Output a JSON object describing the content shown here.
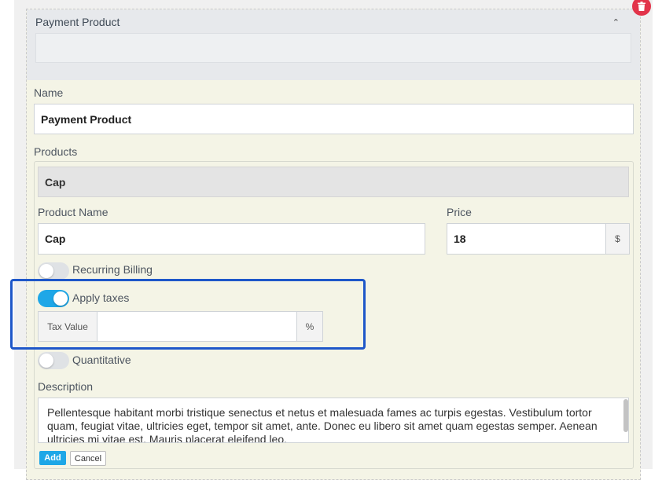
{
  "panel": {
    "title": "Payment Product",
    "collapse_icon": "chevron-up-icon",
    "delete_icon": "trash-icon"
  },
  "form": {
    "name_label": "Name",
    "name_value": "Payment Product",
    "products_label": "Products"
  },
  "product": {
    "header": "Cap",
    "name_label": "Product Name",
    "name_value": "Cap",
    "price_label": "Price",
    "price_value": "18",
    "currency": "$",
    "recurring_label": "Recurring Billing",
    "recurring_on": false,
    "taxes_label": "Apply taxes",
    "taxes_on": true,
    "tax_value_label": "Tax Value",
    "tax_value": "",
    "tax_unit": "%",
    "quantitative_label": "Quantitative",
    "quantitative_on": false,
    "description_label": "Description",
    "description": "Pellentesque habitant morbi tristique senectus et netus et malesuada fames ac turpis egestas. Vestibulum tortor quam, feugiat vitae, ultricies eget, tempor sit amet, ante. Donec eu libero sit amet quam egestas semper. Aenean ultricies mi vitae est. Mauris placerat eleifend leo."
  },
  "actions": {
    "add_label": "Add",
    "cancel_label": "Cancel"
  },
  "colors": {
    "accent": "#1ea7e7",
    "highlight": "#1e57c9",
    "delete": "#e2344a"
  }
}
